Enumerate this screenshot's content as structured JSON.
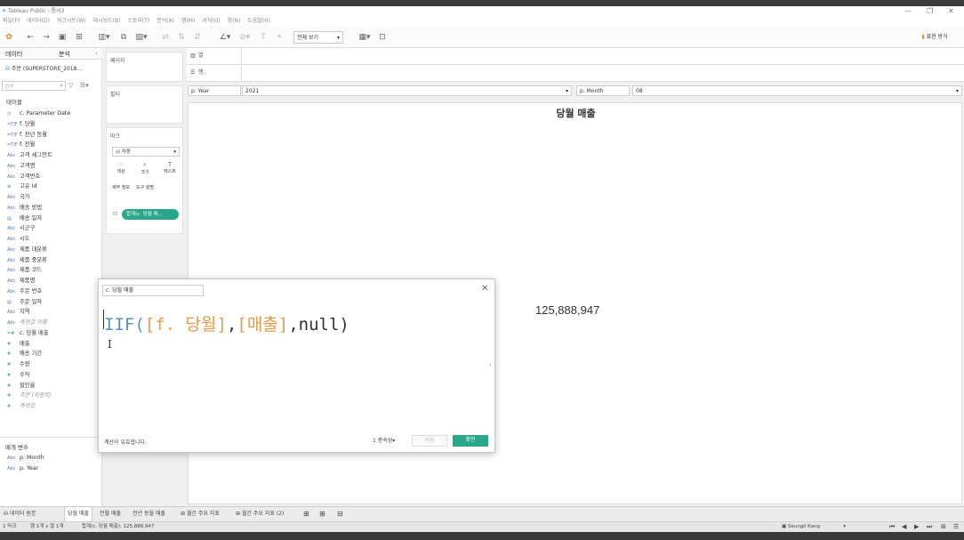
{
  "window": {
    "title": "Tableau Public - 통서3",
    "controls": [
      "—",
      "❐",
      "✕"
    ]
  },
  "menu": [
    "파일(F)",
    "데이터(D)",
    "워크시트(W)",
    "대시보드(B)",
    "스토리(T)",
    "분석(A)",
    "맵(M)",
    "서식(O)",
    "창(N)",
    "도움말(H)"
  ],
  "toolbar": {
    "fit_label": "전체 보기",
    "show_me_label": "표현 방식"
  },
  "left_pane": {
    "tabs": [
      "데이터",
      "분석"
    ],
    "datasource": "주문 (SUPERSTORE_2018...",
    "search_placeholder": "검색",
    "tables_label": "테이블",
    "fields": [
      {
        "icon": "◷",
        "label": "c. Parameter Date",
        "kind": "dim"
      },
      {
        "icon": "=T|F",
        "label": "f. 당월",
        "kind": "dim"
      },
      {
        "icon": "=T|F",
        "label": "f. 전년 동월",
        "kind": "dim"
      },
      {
        "icon": "=T|F",
        "label": "f. 전월",
        "kind": "dim"
      },
      {
        "icon": "Abc",
        "label": "고객 세그먼트",
        "kind": "dim"
      },
      {
        "icon": "Abc",
        "label": "고객명",
        "kind": "dim"
      },
      {
        "icon": "Abc",
        "label": "고객번호",
        "kind": "dim"
      },
      {
        "icon": "⊕",
        "label": "고유 Id",
        "kind": "dim"
      },
      {
        "icon": "Abc",
        "label": "국가",
        "kind": "dim"
      },
      {
        "icon": "Abc",
        "label": "배송 방법",
        "kind": "dim"
      },
      {
        "icon": "▤",
        "label": "배송 일자",
        "kind": "dim"
      },
      {
        "icon": "Abc",
        "label": "시군구",
        "kind": "dim"
      },
      {
        "icon": "Abc",
        "label": "시도",
        "kind": "dim"
      },
      {
        "icon": "Abc",
        "label": "제품 대분류",
        "kind": "dim"
      },
      {
        "icon": "Abc",
        "label": "제품 중분류",
        "kind": "dim"
      },
      {
        "icon": "Abc",
        "label": "제품 코드",
        "kind": "dim"
      },
      {
        "icon": "Abc",
        "label": "제품명",
        "kind": "dim"
      },
      {
        "icon": "Abc",
        "label": "주문 번호",
        "kind": "dim"
      },
      {
        "icon": "▤",
        "label": "주문 일자",
        "kind": "dim"
      },
      {
        "icon": "Abc",
        "label": "지역",
        "kind": "dim"
      },
      {
        "icon": "Abc",
        "label": "측정값 이름",
        "kind": "dim-it"
      },
      {
        "icon": "=#",
        "label": "c. 당월 매출",
        "kind": "mea"
      },
      {
        "icon": "#",
        "label": "매출",
        "kind": "mea"
      },
      {
        "icon": "#",
        "label": "배송 기간",
        "kind": "mea"
      },
      {
        "icon": "#",
        "label": "수량",
        "kind": "mea"
      },
      {
        "icon": "#",
        "label": "수익",
        "kind": "mea"
      },
      {
        "icon": "#",
        "label": "할인율",
        "kind": "mea"
      },
      {
        "icon": "#",
        "label": "주문 (카운트)",
        "kind": "mea-it"
      },
      {
        "icon": "#",
        "label": "측정값",
        "kind": "mea-it"
      }
    ],
    "params_label": "매개 변수",
    "params": [
      {
        "icon": "Abc",
        "label": "p. Month"
      },
      {
        "icon": "Abc",
        "label": "p. Year"
      }
    ]
  },
  "shelves": {
    "pages": "페이지",
    "filters": "필터",
    "marks": "마크",
    "mark_type": "자동",
    "mark_buttons": [
      "색상",
      "크기",
      "텍스트",
      "세부 정보",
      "도구 설명"
    ],
    "pill": "합계(c. 당월 매..."
  },
  "columns_label": "열",
  "rows_label": "행",
  "filters": {
    "year_label": "p. Year",
    "year_value": "2021",
    "month_label": "p. Month",
    "month_value": "08"
  },
  "view": {
    "title": "당월 매출",
    "value": "125,888,947"
  },
  "calc_dialog": {
    "name": "c. 당월 매출",
    "formula_func": "IIF(",
    "formula_field1": "[f. 당월]",
    "formula_sep": ",",
    "formula_field2": "[매출]",
    "formula_tail": ",null)",
    "status": "계산이 유효합니다.",
    "deps_label": "1 종속성",
    "apply_label": "적용",
    "ok_label": "확인"
  },
  "sheet_tabs": [
    "데이터 원본",
    "당월 매출",
    "전월 매출",
    "전년 동월 매출",
    "월간 주요 지표",
    "월간 주요 지표 (2)"
  ],
  "status": {
    "left1": "1 마크",
    "left2": "행 1개 x 열 1개",
    "sum": "합계(c. 당월 매출): 125,888,947",
    "user": "Seungil Kang"
  },
  "colors": {
    "accent": "#2aa68a",
    "formula_func": "#5a8fc9",
    "formula_field": "#e39a4a"
  }
}
